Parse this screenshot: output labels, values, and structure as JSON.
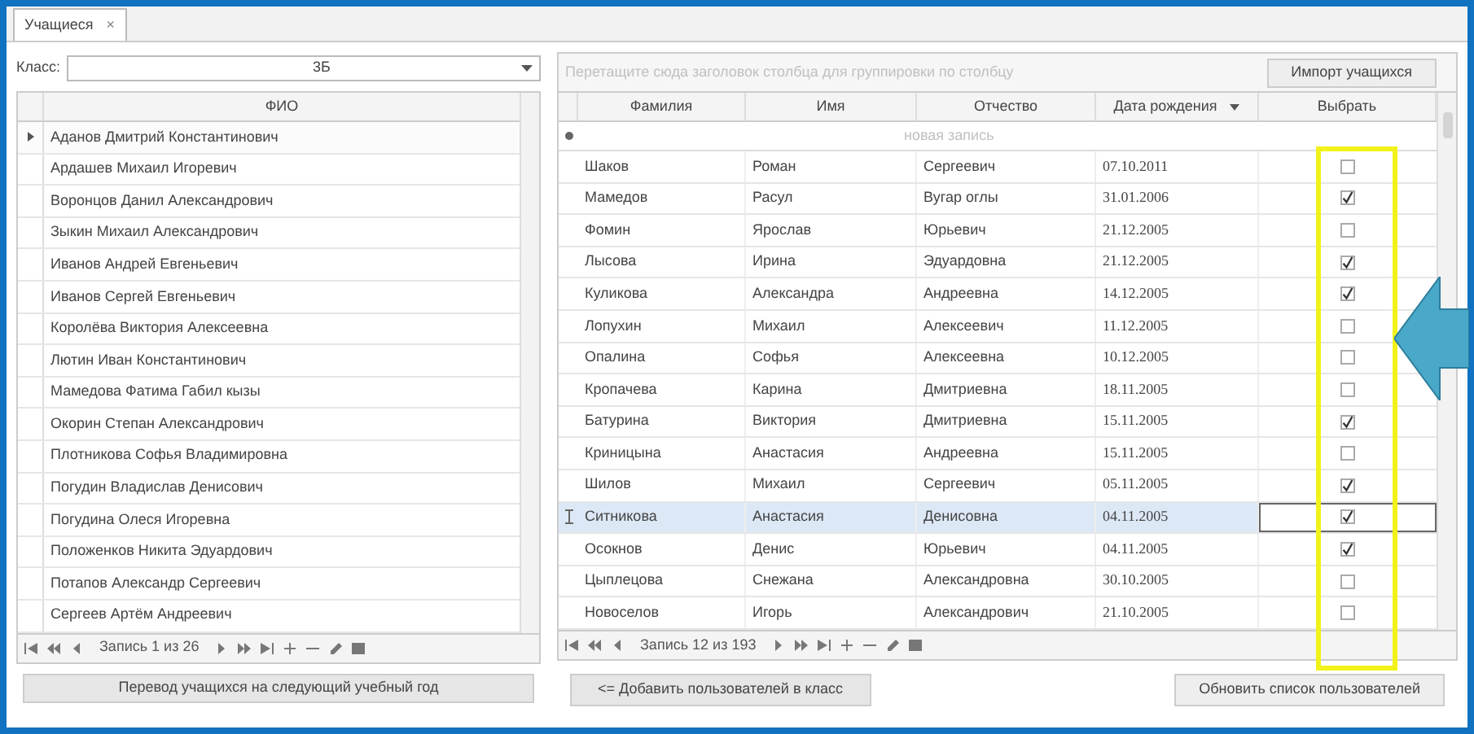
{
  "tabs": [
    {
      "label": "Учащиеся",
      "close": "×",
      "selected": true
    }
  ],
  "left": {
    "class_label": "Класс:",
    "class_value": "3Б",
    "column": "ФИО",
    "rows": [
      {
        "name": "Аданов Дмитрий Константинович",
        "selected": true
      },
      {
        "name": "Ардашев Михаил Игоревич",
        "selected": false
      },
      {
        "name": "Воронцов Данил Александрович",
        "selected": false
      },
      {
        "name": "Зыкин Михаил Александрович",
        "selected": false
      },
      {
        "name": "Иванов Андрей Евгеньевич",
        "selected": false
      },
      {
        "name": "Иванов Сергей Евгеньевич",
        "selected": false
      },
      {
        "name": "Королёва Виктория Алексеевна",
        "selected": false
      },
      {
        "name": "Лютин Иван Константинович",
        "selected": false
      },
      {
        "name": "Мамедова Фатима Габил кызы",
        "selected": false
      },
      {
        "name": "Окорин Степан Александрович",
        "selected": false
      },
      {
        "name": "Плотникова Софья Владимировна",
        "selected": false
      },
      {
        "name": "Погудин Владислав Денисович",
        "selected": false
      },
      {
        "name": "Погудина Олеся Игоревна",
        "selected": false
      },
      {
        "name": "Положенков Никита Эдуардович",
        "selected": false
      },
      {
        "name": "Потапов Александр Сергеевич",
        "selected": false
      },
      {
        "name": "Сергеев Артём Андреевич",
        "selected": false
      }
    ],
    "record": "Запись 1 из 26",
    "button": "Перевод учащихся на следующий учебный год"
  },
  "right": {
    "group_hint": "Перетащите сюда заголовок столбца для группировки по столбцу",
    "import_button": "Импорт учащихся",
    "columns": [
      "Фамилия",
      "Имя",
      "Отчество",
      "Дата рождения",
      "Выбрать"
    ],
    "new_row": "новая запись",
    "rows": [
      {
        "cells": [
          "Шаков",
          "Роман",
          "Сергеевич",
          "07.10.2011"
        ],
        "checked": false,
        "selected": false
      },
      {
        "cells": [
          "Мамедов",
          "Расул",
          "Вугар оглы",
          "31.01.2006"
        ],
        "checked": true,
        "selected": false
      },
      {
        "cells": [
          "Фомин",
          "Ярослав",
          "Юрьевич",
          "21.12.2005"
        ],
        "checked": false,
        "selected": false
      },
      {
        "cells": [
          "Лысова",
          "Ирина",
          "Эдуардовна",
          "21.12.2005"
        ],
        "checked": true,
        "selected": false
      },
      {
        "cells": [
          "Куликова",
          "Александра",
          "Андреевна",
          "14.12.2005"
        ],
        "checked": true,
        "selected": false
      },
      {
        "cells": [
          "Лопухин",
          "Михаил",
          "Алексеевич",
          "11.12.2005"
        ],
        "checked": false,
        "selected": false
      },
      {
        "cells": [
          "Опалина",
          "Софья",
          "Алексеевна",
          "10.12.2005"
        ],
        "checked": false,
        "selected": false
      },
      {
        "cells": [
          "Кропачева",
          "Карина",
          "Дмитриевна",
          "18.11.2005"
        ],
        "checked": false,
        "selected": false
      },
      {
        "cells": [
          "Батурина",
          "Виктория",
          "Дмитриевна",
          "15.11.2005"
        ],
        "checked": true,
        "selected": false
      },
      {
        "cells": [
          "Криницына",
          "Анастасия",
          "Андреевна",
          "15.11.2005"
        ],
        "checked": false,
        "selected": false
      },
      {
        "cells": [
          "Шилов",
          "Михаил",
          "Сергеевич",
          "05.11.2005"
        ],
        "checked": true,
        "selected": false
      },
      {
        "cells": [
          "Ситникова",
          "Анастасия",
          "Денисовна",
          "04.11.2005"
        ],
        "checked": true,
        "selected": true
      },
      {
        "cells": [
          "Осокнов",
          "Денис",
          "Юрьевич",
          "04.11.2005"
        ],
        "checked": true,
        "selected": false
      },
      {
        "cells": [
          "Цыплецова",
          "Снежана",
          "Александровна",
          "30.10.2005"
        ],
        "checked": false,
        "selected": false
      },
      {
        "cells": [
          "Новоселов",
          "Игорь",
          "Александрович",
          "21.10.2005"
        ],
        "checked": false,
        "selected": false
      }
    ],
    "record": "Запись 12 из 193",
    "add_button": "<= Добавить пользователей в класс",
    "refresh_button": "Обновить список пользователей"
  }
}
